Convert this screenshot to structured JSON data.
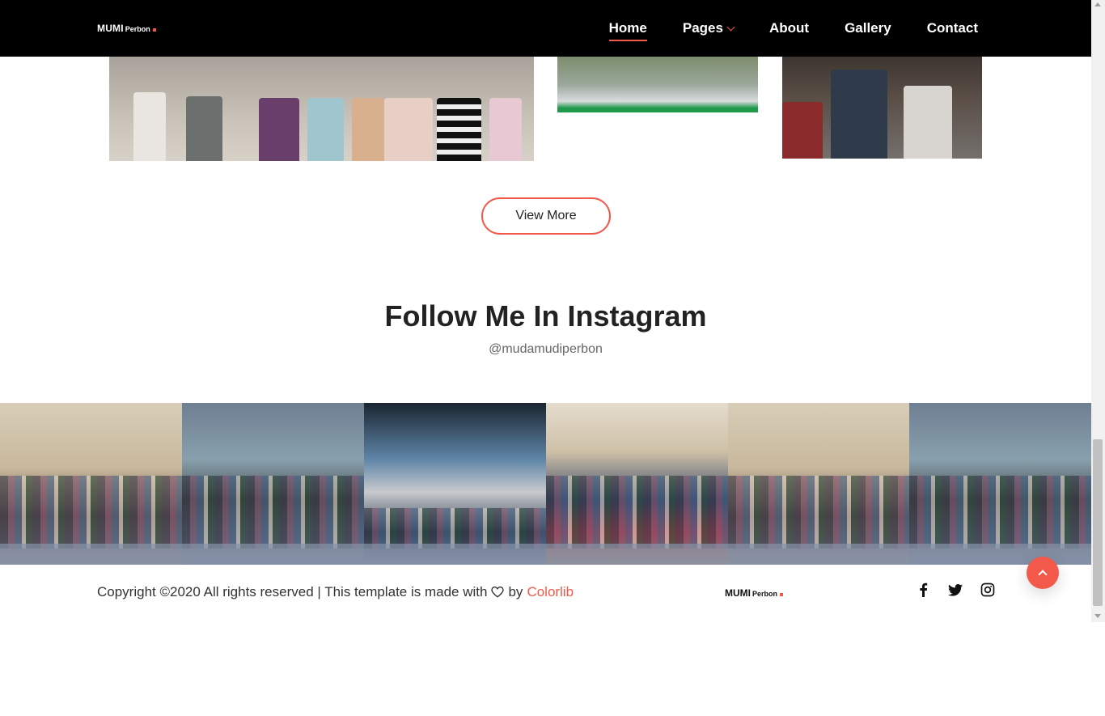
{
  "brand": {
    "main": "MUMI",
    "sub": "Perbon"
  },
  "nav": {
    "items": [
      {
        "label": "Home",
        "active": true
      },
      {
        "label": "Pages",
        "dropdown": true
      },
      {
        "label": "About"
      },
      {
        "label": "Gallery"
      },
      {
        "label": "Contact"
      }
    ]
  },
  "gallery": {
    "view_more_label": "View More"
  },
  "instagram": {
    "title": "Follow Me In Instagram",
    "handle": "@mudamudiperbon"
  },
  "footer": {
    "copyright_prefix": "Copyright ©2020 All rights reserved | This template is made with",
    "copyright_by": "by",
    "copyright_link": "Colorlib",
    "brand_main": "MUMI",
    "brand_sub": "Perbon",
    "socials": [
      "facebook-icon",
      "twitter-icon",
      "instagram-icon"
    ]
  },
  "colors": {
    "accent": "#f2594b",
    "nav_bg": "#000000",
    "text": "#222222"
  }
}
